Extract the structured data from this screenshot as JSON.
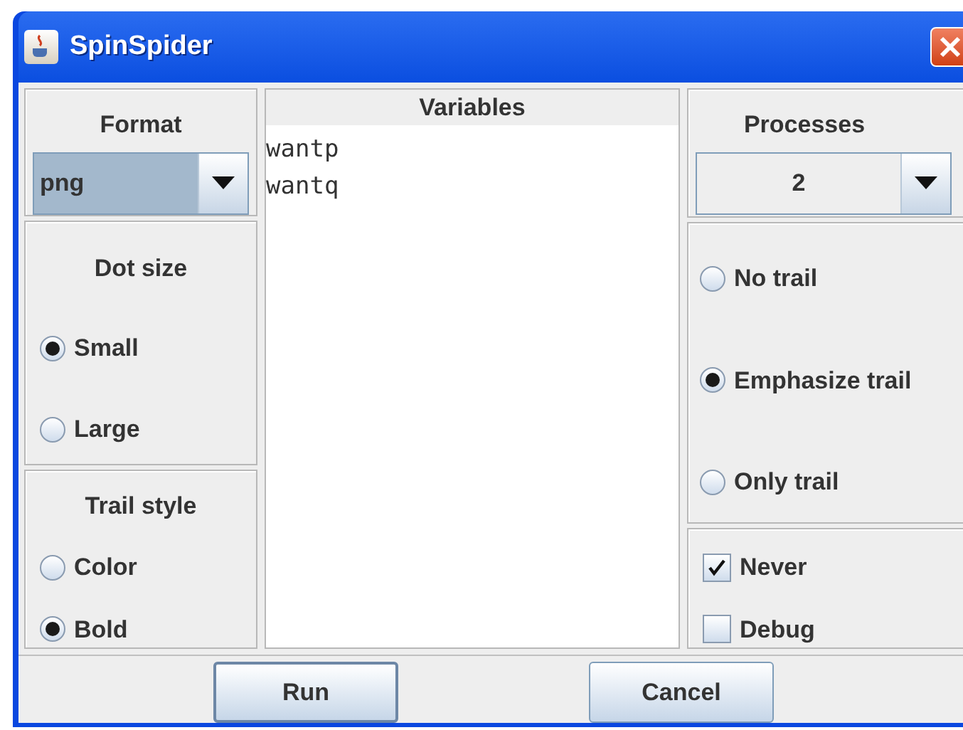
{
  "window": {
    "title": "SpinSpider"
  },
  "format": {
    "label": "Format",
    "value": "png",
    "focused": true
  },
  "dot_size": {
    "label": "Dot size",
    "options": [
      {
        "label": "Small",
        "selected": true
      },
      {
        "label": "Large",
        "selected": false
      }
    ]
  },
  "trail_style": {
    "label": "Trail style",
    "options": [
      {
        "label": "Color",
        "selected": false
      },
      {
        "label": "Bold",
        "selected": true
      }
    ]
  },
  "variables": {
    "header": "Variables",
    "items": [
      "wantp",
      "wantq"
    ]
  },
  "processes": {
    "label": "Processes",
    "value": "2",
    "focused": false
  },
  "trail": {
    "options": [
      {
        "label": "No trail",
        "selected": false
      },
      {
        "label": "Emphasize trail",
        "selected": true
      },
      {
        "label": "Only trail",
        "selected": false
      }
    ]
  },
  "checks": [
    {
      "label": "Never",
      "checked": true
    },
    {
      "label": "Debug",
      "checked": false
    }
  ],
  "buttons": [
    {
      "label": "Run",
      "focused": true
    },
    {
      "label": "Cancel",
      "focused": false
    }
  ]
}
